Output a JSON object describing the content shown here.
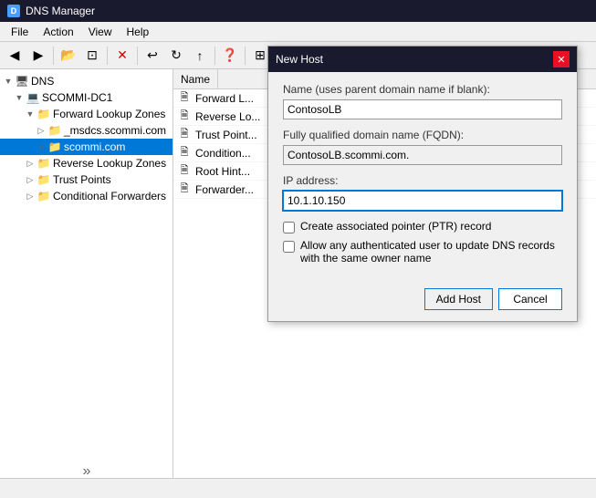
{
  "titleBar": {
    "icon": "D",
    "title": "DNS Manager"
  },
  "menuBar": {
    "items": [
      "File",
      "Action",
      "View",
      "Help"
    ]
  },
  "toolbar": {
    "buttons": [
      {
        "icon": "←",
        "label": "back"
      },
      {
        "icon": "→",
        "label": "forward"
      },
      {
        "icon": "📁",
        "label": "open"
      },
      {
        "icon": "⊡",
        "label": "view"
      },
      {
        "icon": "✕",
        "label": "delete"
      },
      {
        "icon": "↩",
        "label": "refresh1"
      },
      {
        "icon": "↻",
        "label": "refresh2"
      },
      {
        "icon": "↑",
        "label": "up"
      },
      {
        "icon": "?",
        "label": "help"
      },
      {
        "icon": "⊞",
        "label": "grid"
      },
      {
        "icon": "≡",
        "label": "list"
      },
      {
        "icon": "⊟",
        "label": "detail"
      },
      {
        "icon": "⊠",
        "label": "tiles"
      }
    ]
  },
  "tree": {
    "items": [
      {
        "id": "dns",
        "label": "DNS",
        "level": 0,
        "icon": "🖥",
        "expanded": true,
        "type": "root"
      },
      {
        "id": "scommi-dc1",
        "label": "SCOMMI-DC1",
        "level": 1,
        "icon": "💻",
        "expanded": true,
        "type": "server"
      },
      {
        "id": "forward-lookup",
        "label": "Forward Lookup Zones",
        "level": 2,
        "icon": "📁",
        "expanded": true,
        "type": "folder"
      },
      {
        "id": "_msdcs",
        "label": "_msdcs.scommi.com",
        "level": 3,
        "icon": "📁",
        "type": "folder"
      },
      {
        "id": "scommi",
        "label": "scommi.com",
        "level": 3,
        "icon": "📁",
        "selected": true,
        "type": "folder"
      },
      {
        "id": "reverse-lookup",
        "label": "Reverse Lookup Zones",
        "level": 2,
        "icon": "📁",
        "type": "folder"
      },
      {
        "id": "trust-points",
        "label": "Trust Points",
        "level": 2,
        "icon": "📁",
        "type": "folder"
      },
      {
        "id": "conditional",
        "label": "Conditional Forwarders",
        "level": 2,
        "icon": "📁",
        "type": "folder"
      }
    ]
  },
  "listHeader": {
    "columns": [
      "Name"
    ]
  },
  "listItems": [
    {
      "icon": "🗎",
      "label": "Forward L..."
    },
    {
      "icon": "🗎",
      "label": "Reverse Lo..."
    },
    {
      "icon": "🗎",
      "label": "Trust Point..."
    },
    {
      "icon": "🗎",
      "label": "Condition..."
    },
    {
      "icon": "🗎",
      "label": "Root Hint..."
    },
    {
      "icon": "🗎",
      "label": "Forwarder..."
    }
  ],
  "dialog": {
    "title": "New Host",
    "closeBtn": "✕",
    "nameLabel": "Name (uses parent domain name if blank):",
    "nameValue": "ContosoLB",
    "fqdnLabel": "Fully qualified domain name (FQDN):",
    "fqdnValue": "ContosoLB.scommi.com.",
    "ipLabel": "IP address:",
    "ipValue": "10.1.10.150",
    "checkbox1Label": "Create associated pointer (PTR) record",
    "checkbox2Label": "Allow any authenticated user to update DNS records with the same owner name",
    "addHostBtn": "Add Host",
    "cancelBtn": "Cancel"
  },
  "statusBar": {
    "doubleArrow": "»"
  }
}
